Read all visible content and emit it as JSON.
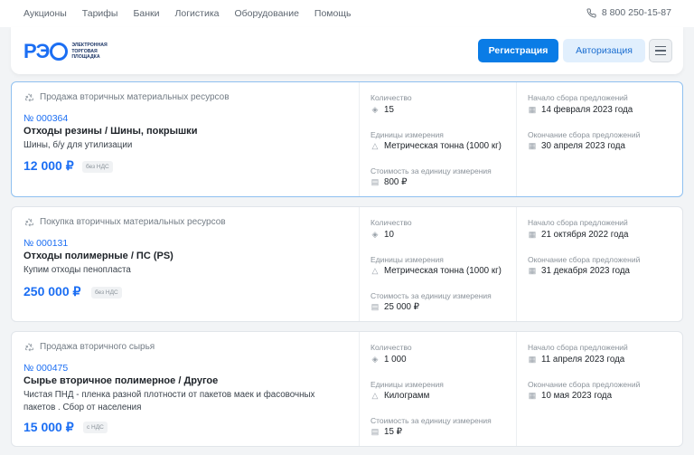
{
  "topnav": {
    "links": [
      "Аукционы",
      "Тарифы",
      "Банки",
      "Логистика",
      "Оборудование",
      "Помощь"
    ],
    "phone": "8 800 250-15-87"
  },
  "header": {
    "logo_mark": "РЭ",
    "logo_text": [
      "Электронная",
      "торговая",
      "площадка"
    ],
    "register": "Регистрация",
    "login": "Авторизация"
  },
  "labels": {
    "quantity": "Количество",
    "unit": "Единицы измерения",
    "unit_price": "Стоимость за единицу измерения",
    "start": "Начало сбора предложений",
    "end": "Окончание сбора предложений"
  },
  "lots": [
    {
      "category": "Продажа вторичных материальных ресурсов",
      "number": "№ 000364",
      "title": "Отходы резины / Шины, покрышки",
      "description": "Шины, б/у для утилизации",
      "price": "12 000 ₽",
      "vat": "без НДС",
      "quantity": "15",
      "unit": "Метрическая тонна (1000 кг)",
      "unit_price": "800 ₽",
      "start": "14 февраля 2023 года",
      "end": "30 апреля 2023 года"
    },
    {
      "category": "Покупка вторичных материальных ресурсов",
      "number": "№ 000131",
      "title": "Отходы полимерные / ПС (PS)",
      "description": "Купим отходы пенопласта",
      "price": "250 000 ₽",
      "vat": "без НДС",
      "quantity": "10",
      "unit": "Метрическая тонна (1000 кг)",
      "unit_price": "25 000 ₽",
      "start": "21 октября 2022 года",
      "end": "31 декабря 2023 года"
    },
    {
      "category": "Продажа вторичного сырья",
      "number": "№ 000475",
      "title": "Сырье вторичное полимерное / Другое",
      "description": "Чистая ПНД - пленка разной плотности от пакетов маек и фасовочных пакетов . Сбор от населения",
      "price": "15 000 ₽",
      "vat": "с НДС",
      "quantity": "1 000",
      "unit": "Килограмм",
      "unit_price": "15 ₽",
      "start": "11 апреля 2023 года",
      "end": "10 мая 2023 года"
    }
  ]
}
